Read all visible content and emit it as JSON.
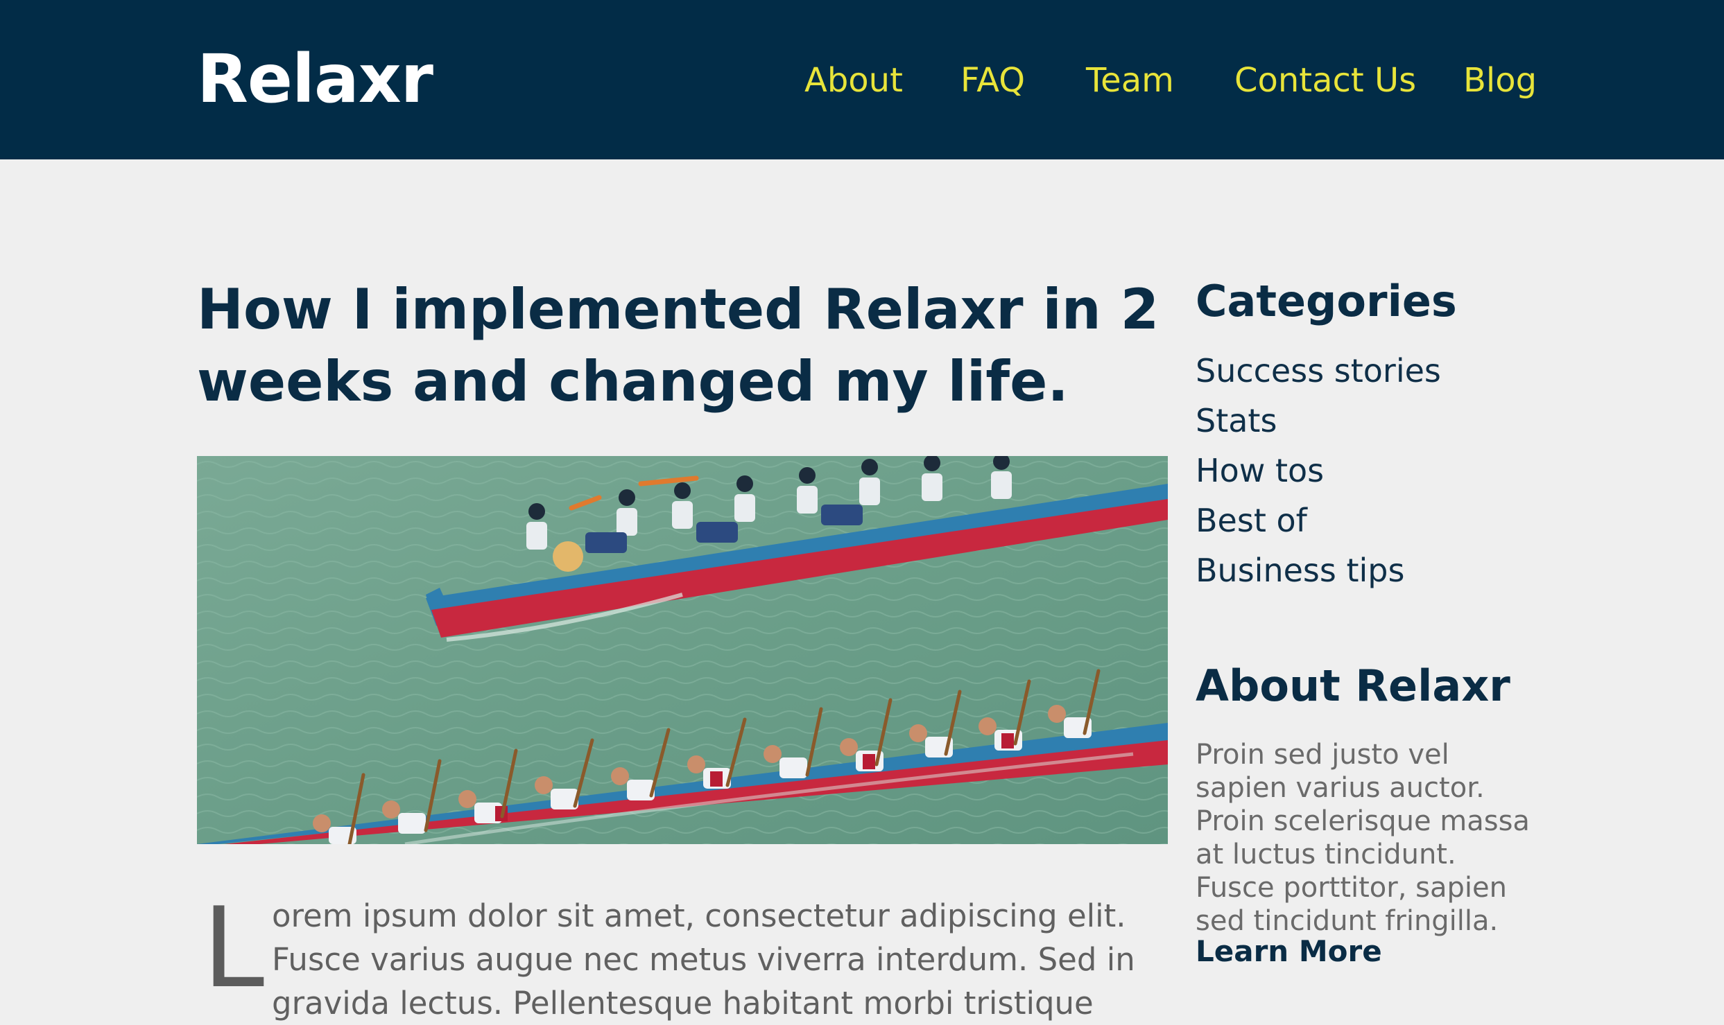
{
  "header": {
    "brand": "Relaxr",
    "nav": [
      {
        "label": "About"
      },
      {
        "label": "FAQ"
      },
      {
        "label": "Team"
      },
      {
        "label": "Contact Us"
      },
      {
        "label": "Blog"
      }
    ]
  },
  "post": {
    "title": "How I implemented Relaxr in 2 weeks and changed my life.",
    "image_subject": "dragon boat racing photo",
    "drop_cap": "L",
    "intro": "orem ipsum dolor sit amet, consectetur adipiscing elit. Fusce varius augue nec metus viverra interdum. Sed in gravida lectus. Pellentesque habitant morbi tristique"
  },
  "sidebar": {
    "categories_heading": "Categories",
    "categories": [
      {
        "label": "Success stories"
      },
      {
        "label": "Stats"
      },
      {
        "label": "How tos"
      },
      {
        "label": "Best of"
      },
      {
        "label": "Business tips"
      }
    ],
    "about_heading": "About Relaxr",
    "about_text": "Proin sed justo vel sapien varius auctor. Proin scelerisque massa at luctus tincidunt. Fusce porttitor, sapien sed tincidunt fringilla.",
    "learn_more": "Learn More"
  },
  "colors": {
    "header_bg": "#022c47",
    "nav_link": "#e8e43a",
    "page_bg": "#efefef",
    "heading": "#0a2c45"
  }
}
